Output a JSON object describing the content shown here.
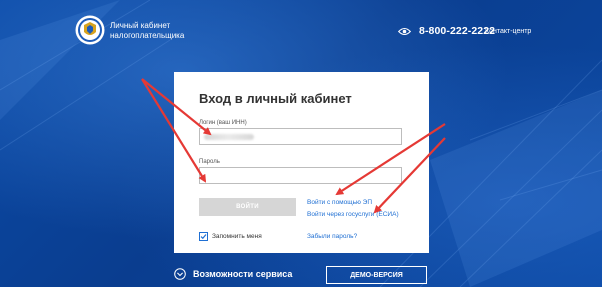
{
  "header": {
    "brand_line1": "Личный кабинет",
    "brand_line2": "налогоплательщика",
    "phone": "8-800-222-2222",
    "contact": "Контакт-центр",
    "logo_icon": "emblem-icon",
    "accessibility_icon": "eye-icon"
  },
  "login": {
    "title": "Вход в личный кабинет",
    "login_label": "Логин (ваш ИНН)",
    "password_label": "Пароль",
    "submit_label": "ВОЙТИ",
    "ep_link": "Войти с помощью ЭП",
    "esia_link": "Войти через госуслуги (ЕСИА)",
    "remember_label": "Запомнить меня",
    "remember_checked": true,
    "forgot_link": "Забыли пароль?"
  },
  "footer": {
    "features_label": "Возможности сервиса",
    "demo_label": "ДЕМО-ВЕРСИЯ"
  },
  "colors": {
    "background": "#0a3f93",
    "link": "#1f6fd3",
    "annotation_arrow": "#e53935",
    "button_disabled": "#d6d6d6"
  }
}
